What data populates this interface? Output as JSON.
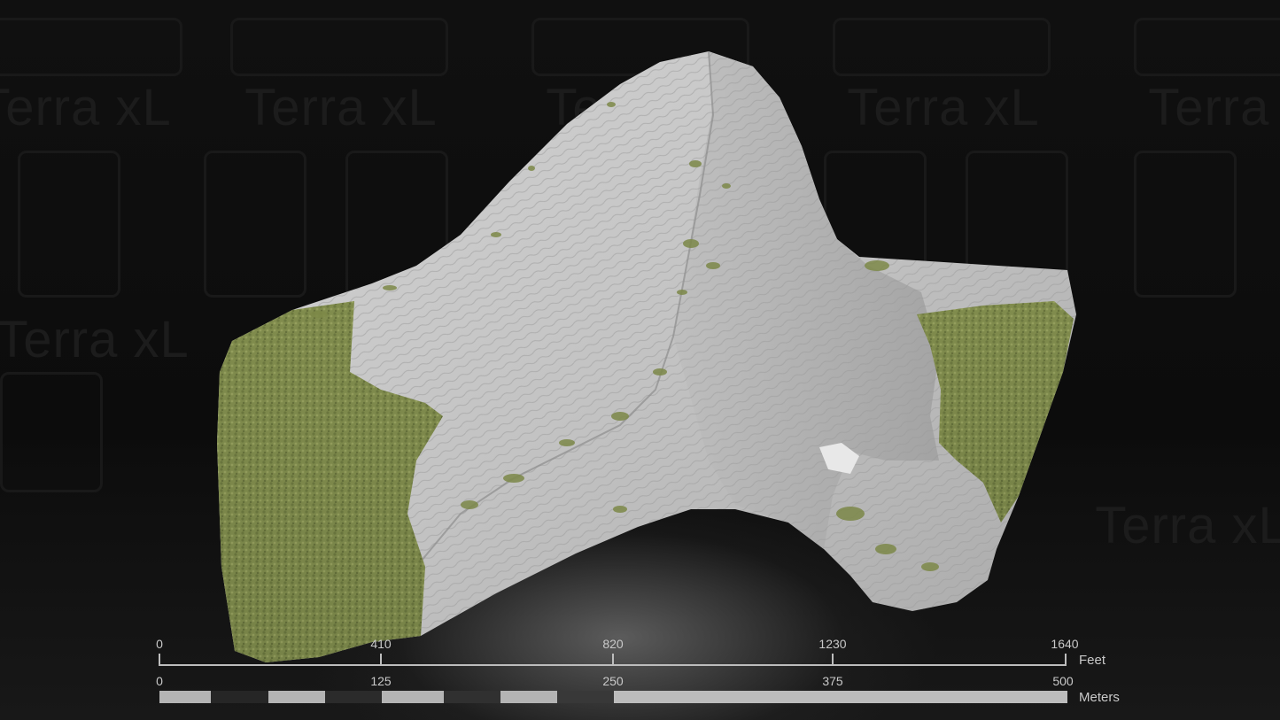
{
  "watermark": {
    "brand": "Terra xL"
  },
  "scene": {
    "subject": "3d-terrain-model-mountain-peak"
  },
  "feet_scale": {
    "labels": [
      "0",
      "410",
      "820",
      "1230",
      "1640"
    ],
    "unit": "Feet"
  },
  "meter_scale": {
    "labels": [
      "0",
      "125",
      "250",
      "375",
      "500"
    ],
    "unit": "Meters"
  },
  "colors": {
    "background": "#0b0b0b",
    "rock": "#c8c8c8",
    "vegetation": "#7f8a4a",
    "scale_light": "#b8b8b8",
    "scale_dark": "#2a2a2a"
  }
}
